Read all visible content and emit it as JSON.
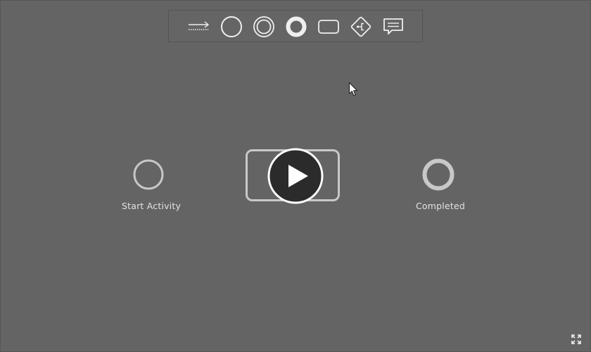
{
  "toolbar": {
    "tools": [
      {
        "icon": "sequence-flow-arrow-icon"
      },
      {
        "icon": "start-event-circle-icon"
      },
      {
        "icon": "intermediate-event-double-circle-icon"
      },
      {
        "icon": "end-event-thick-circle-icon"
      },
      {
        "icon": "task-rounded-rectangle-icon"
      },
      {
        "icon": "gateway-diamond-icon"
      },
      {
        "icon": "annotation-comment-icon"
      }
    ]
  },
  "diagram": {
    "start_label": "Start Activity",
    "end_label": "Completed"
  },
  "colors": {
    "background": "#646464",
    "shape_stroke": "#c8c8c8",
    "play_button": "#2b2b2b"
  }
}
